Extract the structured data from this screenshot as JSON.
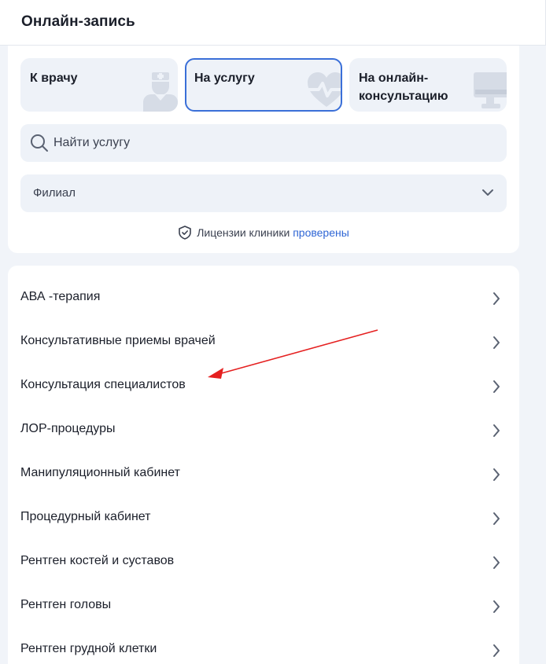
{
  "header": {
    "title": "Онлайн-запись"
  },
  "tabs": [
    {
      "label": "К врачу",
      "icon": "doctor-icon"
    },
    {
      "label": "На услугу",
      "icon": "heart-pulse-icon"
    },
    {
      "label": "На онлайн-консультацию",
      "icon": "monitor-icon"
    }
  ],
  "active_tab": 1,
  "search": {
    "placeholder": "Найти услугу",
    "value": ""
  },
  "branch": {
    "label": "Филиал"
  },
  "license": {
    "text": "Лицензии клиники",
    "link": "проверены"
  },
  "services": [
    {
      "label": "АВА -терапия"
    },
    {
      "label": "Консультативные приемы врачей"
    },
    {
      "label": "Консультация специалистов"
    },
    {
      "label": "ЛОР-процедуры"
    },
    {
      "label": "Манипуляционный кабинет"
    },
    {
      "label": "Процедурный кабинет"
    },
    {
      "label": "Рентген костей и суставов"
    },
    {
      "label": "Рентген головы"
    },
    {
      "label": "Рентген грудной клетки"
    }
  ],
  "colors": {
    "accent": "#2f66d5",
    "active_border": "#3a6fd8",
    "field_bg": "#eef2f8",
    "page_bg": "#f1f4f9",
    "annotation_arrow": "#e52020"
  }
}
